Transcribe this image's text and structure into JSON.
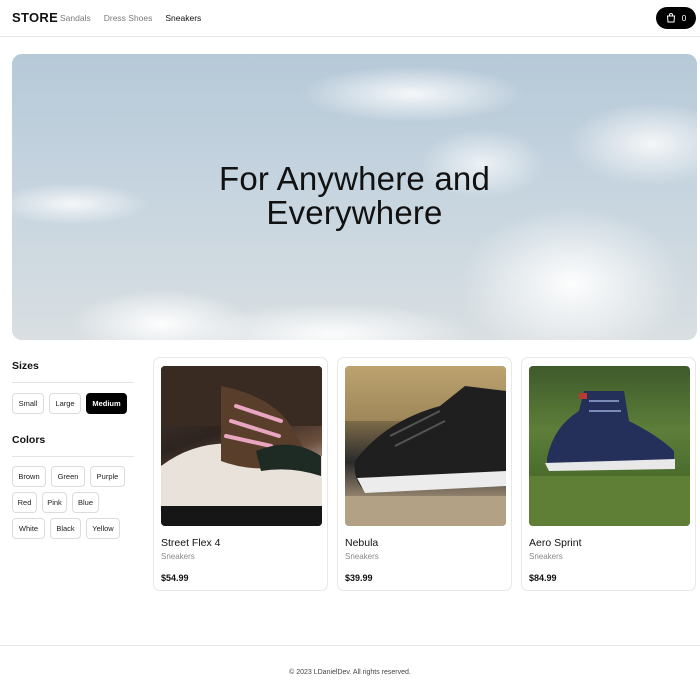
{
  "header": {
    "logo": "STORE",
    "nav": [
      {
        "label": "Sandals",
        "active": false
      },
      {
        "label": "Dress Shoes",
        "active": false
      },
      {
        "label": "Sneakers",
        "active": true
      }
    ],
    "cart_count": "0",
    "cart_icon": "shopping-bag-icon"
  },
  "hero": {
    "title_line1": "For Anywhere and",
    "title_line2": "Everywhere"
  },
  "filters": {
    "sizes": {
      "title": "Sizes",
      "options": [
        "Small",
        "Large",
        "Medium"
      ],
      "selected": "Medium"
    },
    "colors": {
      "title": "Colors",
      "options": [
        "Brown",
        "Green",
        "Purple",
        "Red",
        "Pink",
        "Blue",
        "White",
        "Black",
        "Yellow"
      ]
    }
  },
  "products": [
    {
      "name": "Street Flex 4",
      "category": "Sneakers",
      "price": "$54.99"
    },
    {
      "name": "Nebula",
      "category": "Sneakers",
      "price": "$39.99"
    },
    {
      "name": "Aero Sprint",
      "category": "Sneakers",
      "price": "$84.99"
    }
  ],
  "footer": {
    "text": "© 2023 LDanielDev. All rights reserved."
  }
}
